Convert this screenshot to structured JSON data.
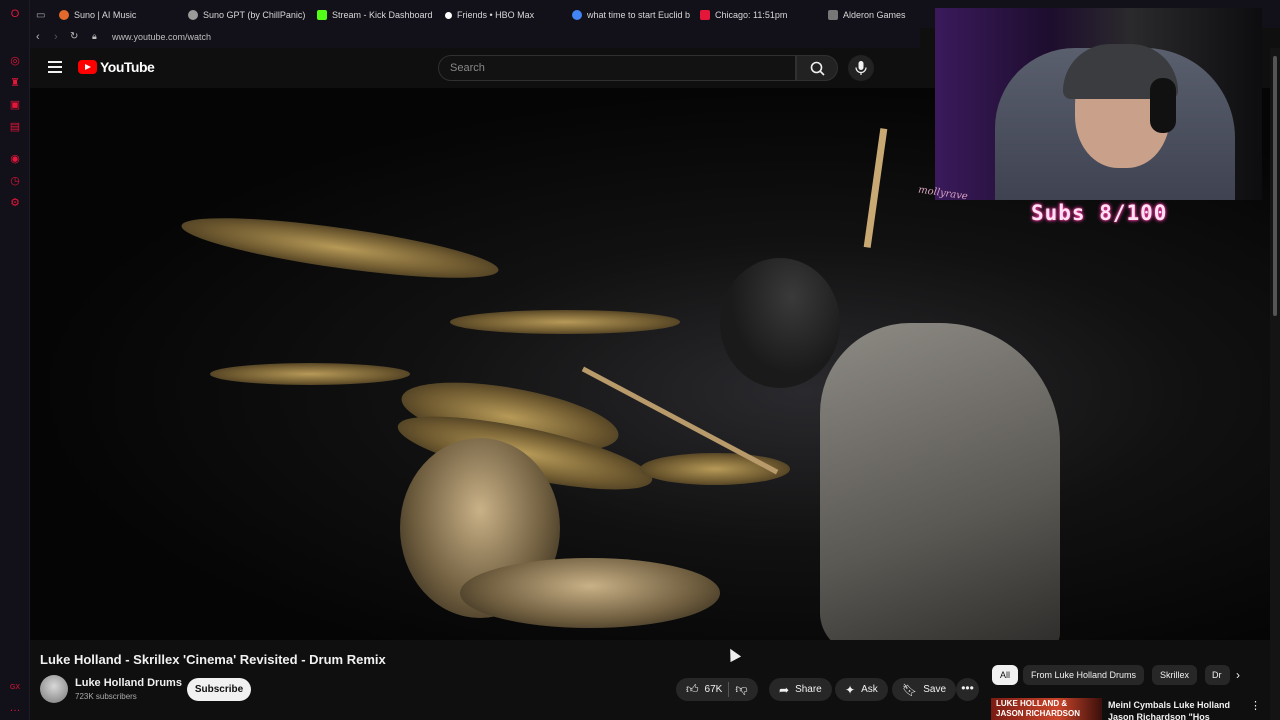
{
  "browser": {
    "tabs": [
      {
        "label": "Suno | AI Music",
        "color": "#e46a2b"
      },
      {
        "label": "Suno GPT (by ChillPanic)",
        "color": "#bbbbbb"
      },
      {
        "label": "Stream - Kick Dashboard",
        "color": "#53fc18"
      },
      {
        "label": "Friends • HBO Max",
        "color": "#ffffff"
      },
      {
        "label": "what time to start Euclid b",
        "color": "#4285f4"
      },
      {
        "label": "Chicago: 11:51pm",
        "color": "#e4163a"
      },
      {
        "label": "Alderon Games",
        "color": "#9a9a9a"
      }
    ],
    "url": "www.youtube.com/watch",
    "accent": "#e4163a",
    "rail_icons": [
      "opera-gx-icon",
      "messenger-icon",
      "twitch-icon",
      "instagram-icon",
      "music-icon",
      "history-icon",
      "settings-icon"
    ],
    "rail_bottom_label": "GX"
  },
  "youtube": {
    "logo_text": "YouTube",
    "search_placeholder": "Search",
    "video": {
      "title": "Luke Holland - Skrillex 'Cinema' Revisited - Drum Remix",
      "channel": "Luke Holland Drums",
      "subscribers": "723K subscribers",
      "subscribe_label": "Subscribe",
      "likes": "67K",
      "share_label": "Share",
      "ask_label": "Ask",
      "save_label": "Save"
    },
    "chips": [
      "All",
      "From Luke Holland Drums",
      "Skrillex",
      "Dr"
    ],
    "recommendation": {
      "thumb_text_line1": "LUKE HOLLAND &",
      "thumb_text_line2": "JASON RICHARDSON",
      "title": "Meinl Cymbals Luke Holland Jason Richardson \"Hos Down\""
    }
  },
  "overlay": {
    "subs_counter": "Subs 8/100",
    "signature": "mollyrave"
  }
}
